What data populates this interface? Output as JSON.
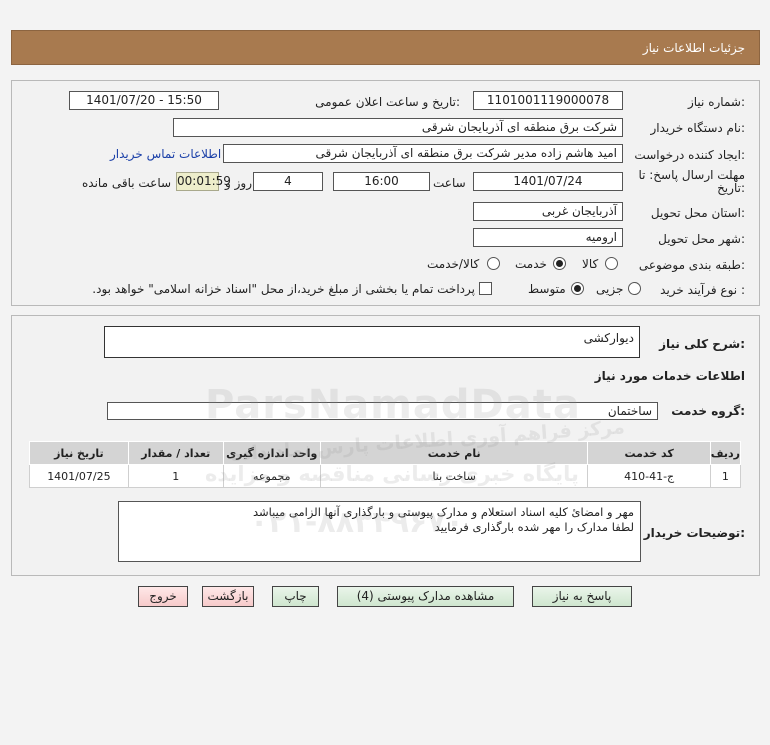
{
  "header": {
    "title": "جزئیات اطلاعات نیاز"
  },
  "form": {
    "need_number_label": "شماره نیاز:",
    "need_number": "1101001119000078",
    "announce_label": "تاریخ و ساعت اعلان عمومی:",
    "announce_value": "1401/07/20 - 15:50",
    "buyer_org_label": "نام دستگاه خریدار:",
    "buyer_org": "شرکت برق منطقه ای آذربایجان شرقی",
    "creator_label": "ایجاد کننده درخواست:",
    "creator": "امید هاشم زاده مدیر شرکت برق منطقه ای آذربایجان شرقی",
    "contact_link": "اطلاعات تماس خریدار",
    "deadline_label_line1": "مهلت ارسال پاسخ: تا",
    "deadline_label_line2": "تاریخ:",
    "deadline_date": "1401/07/24",
    "time_label": "ساعت",
    "deadline_time": "16:00",
    "days_value": "4",
    "days_label": "روز و",
    "remaining_timer": "00:01:59",
    "remaining_label": "ساعت باقی مانده",
    "province_label": "استان محل تحویل:",
    "province": "آذربایجان غربی",
    "city_label": "شهر محل تحویل:",
    "city": "ارومیه",
    "category_label": "طبقه بندی موضوعی:",
    "category_options": [
      "کالا",
      "خدمت",
      "کالا/خدمت"
    ],
    "category_selected": "خدمت",
    "process_label": "نوع فرآیند خرید :",
    "process_options": [
      "جزیی",
      "متوسط"
    ],
    "process_selected": "متوسط",
    "payment_note": "پرداخت تمام یا بخشی از مبلغ خرید،از محل \"اسناد خزانه اسلامی\" خواهد بود."
  },
  "details": {
    "general_desc_label": "شرح کلی نیاز:",
    "general_desc": "دیوارکشی",
    "services_heading": "اطلاعات خدمات مورد نیاز",
    "service_group_label": "گروه خدمت:",
    "service_group": "ساختمان",
    "table": {
      "headers": [
        "ردیف",
        "کد خدمت",
        "نام خدمت",
        "واحد اندازه گیری",
        "تعداد / مقدار",
        "تاریخ نیاز"
      ],
      "rows": [
        [
          "1",
          "ج-41-410",
          "ساخت بنا",
          "مجموعه",
          "1",
          "1401/07/25"
        ]
      ]
    },
    "buyer_notes_label": "توضیحات خریدار:",
    "buyer_notes_line1": "مهر و امضائ کلیه اسناد استعلام و مدارک پیوستی و بارگذاری آنها الزامی میباشد",
    "buyer_notes_line2": "لطفا مدارک را مهر شده بارگذاری فرمایید"
  },
  "buttons": {
    "reply": "پاسخ به نیاز",
    "view_docs": "مشاهده مدارک پیوستی (4)",
    "print": "چاپ",
    "back": "بازگشت",
    "exit": "خروج"
  },
  "watermark": {
    "brand": "ParsNamadData",
    "line1": "مرکز فراهم آوری اطلاعات پارس نماد داده",
    "line2": "پایگاه خبری رسانی مناقصه و مزایده",
    "phone": "۰۲۱-۸۸۳۴۹۶۷۰"
  }
}
